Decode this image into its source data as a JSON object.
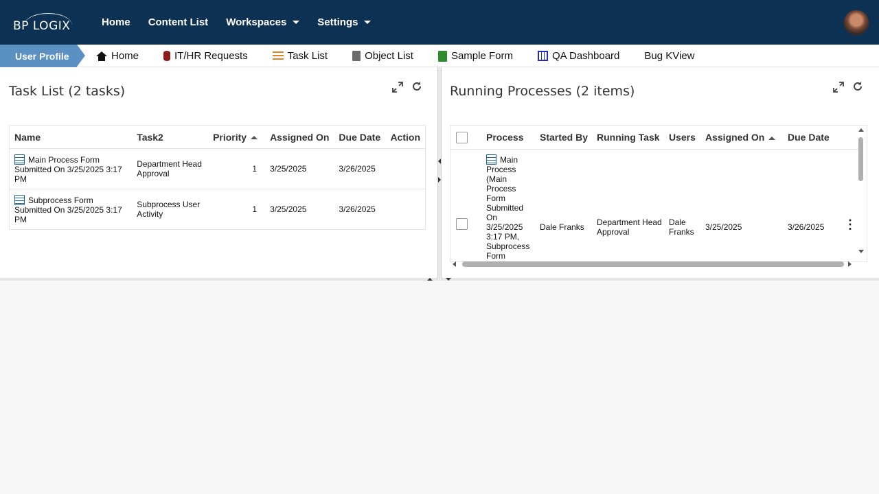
{
  "app": {
    "logo_text": "BP LOGIX",
    "nav": [
      {
        "label": "Home"
      },
      {
        "label": "Content List"
      },
      {
        "label": "Workspaces",
        "dropdown": true
      },
      {
        "label": "Settings",
        "dropdown": true
      }
    ]
  },
  "tabs": {
    "active": "User Profile",
    "items": [
      {
        "label": "Home",
        "icon": "home-icon"
      },
      {
        "label": "IT/HR Requests",
        "icon": "database-icon"
      },
      {
        "label": "Task List",
        "icon": "task-list-icon"
      },
      {
        "label": "Object List",
        "icon": "document-icon"
      },
      {
        "label": "Sample Form",
        "icon": "form-icon"
      },
      {
        "label": "QA Dashboard",
        "icon": "dashboard-icon"
      },
      {
        "label": "Bug KView",
        "icon": ""
      }
    ]
  },
  "task_list": {
    "title": "Task List (2 tasks)",
    "columns": [
      "Name",
      "Task2",
      "Priority",
      "Assigned On",
      "Due Date",
      "Action"
    ],
    "rows": [
      {
        "name": "Main Process Form Submitted On 3/25/2025 3:17 PM",
        "task": "Department Head Approval",
        "priority": "1",
        "assigned_on": "3/25/2025",
        "due_date": "3/26/2025",
        "action": ""
      },
      {
        "name": "Subprocess Form Submitted On 3/25/2025 3:17 PM",
        "task": "Subprocess User Activity",
        "priority": "1",
        "assigned_on": "3/25/2025",
        "due_date": "3/26/2025",
        "action": ""
      }
    ]
  },
  "running_processes": {
    "title": "Running Processes (2 items)",
    "columns": [
      "Process",
      "Started By",
      "Running Task",
      "Users",
      "Assigned On",
      "Due Date"
    ],
    "rows": [
      {
        "process": "Main Process (Main Process Form Submitted On 3/25/2025 3:17 PM, Subprocess Form",
        "started_by": "Dale Franks",
        "running_task": "Department Head Approval",
        "users": "Dale Franks",
        "assigned_on": "3/25/2025",
        "due_date": "3/26/2025"
      }
    ]
  },
  "colors": {
    "navbar": "#0d3152",
    "active_tab": "#5a91c2"
  }
}
